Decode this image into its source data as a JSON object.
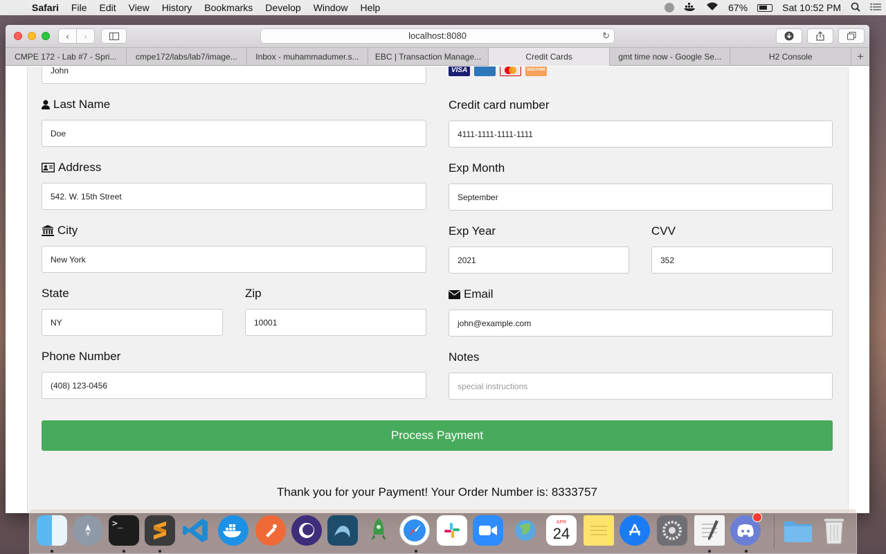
{
  "menubar": {
    "app_name": "Safari",
    "items": [
      "File",
      "Edit",
      "View",
      "History",
      "Bookmarks",
      "Develop",
      "Window",
      "Help"
    ],
    "battery": "67%",
    "clock": "Sat 10:52 PM"
  },
  "browser": {
    "url": "localhost:8080",
    "tabs": [
      {
        "label": "CMPE 172 - Lab #7 - Spri...",
        "active": false
      },
      {
        "label": "cmpe172/labs/lab7/image...",
        "active": false
      },
      {
        "label": "Inbox - muhammadumer.s...",
        "active": false
      },
      {
        "label": "EBC | Transaction Manage...",
        "active": false
      },
      {
        "label": "Credit Cards",
        "active": true
      },
      {
        "label": "gmt time now - Google Se...",
        "active": false
      },
      {
        "label": "H2 Console",
        "active": false
      }
    ]
  },
  "form": {
    "first_name_value": "John",
    "last_name": {
      "label": "Last Name",
      "value": "Doe"
    },
    "address": {
      "label": "Address",
      "value": "542. W. 15th Street"
    },
    "city": {
      "label": "City",
      "value": "New York"
    },
    "state": {
      "label": "State",
      "value": "NY"
    },
    "zip": {
      "label": "Zip",
      "value": "10001"
    },
    "phone": {
      "label": "Phone Number",
      "value": "(408) 123-0456"
    },
    "card_number": {
      "label": "Credit card number",
      "value": "4111-1111-1111-1111"
    },
    "exp_month": {
      "label": "Exp Month",
      "value": "September"
    },
    "exp_year": {
      "label": "Exp Year",
      "value": "2021"
    },
    "cvv": {
      "label": "CVV",
      "value": "352"
    },
    "email": {
      "label": "Email",
      "value": "john@example.com"
    },
    "notes": {
      "label": "Notes",
      "placeholder": "special instructions"
    },
    "accepted_cards": [
      "VISA",
      "AMERICAN EXPRESS",
      "mastercard",
      "DISCOVER"
    ],
    "submit_label": "Process Payment",
    "confirmation": "Thank you for your Payment! Your Order Number is: 8333757"
  },
  "dock": {
    "calendar_month": "APR",
    "calendar_day": "24"
  },
  "colors": {
    "submit_button": "#46ab5a",
    "page_background": "#f1f1f1"
  }
}
